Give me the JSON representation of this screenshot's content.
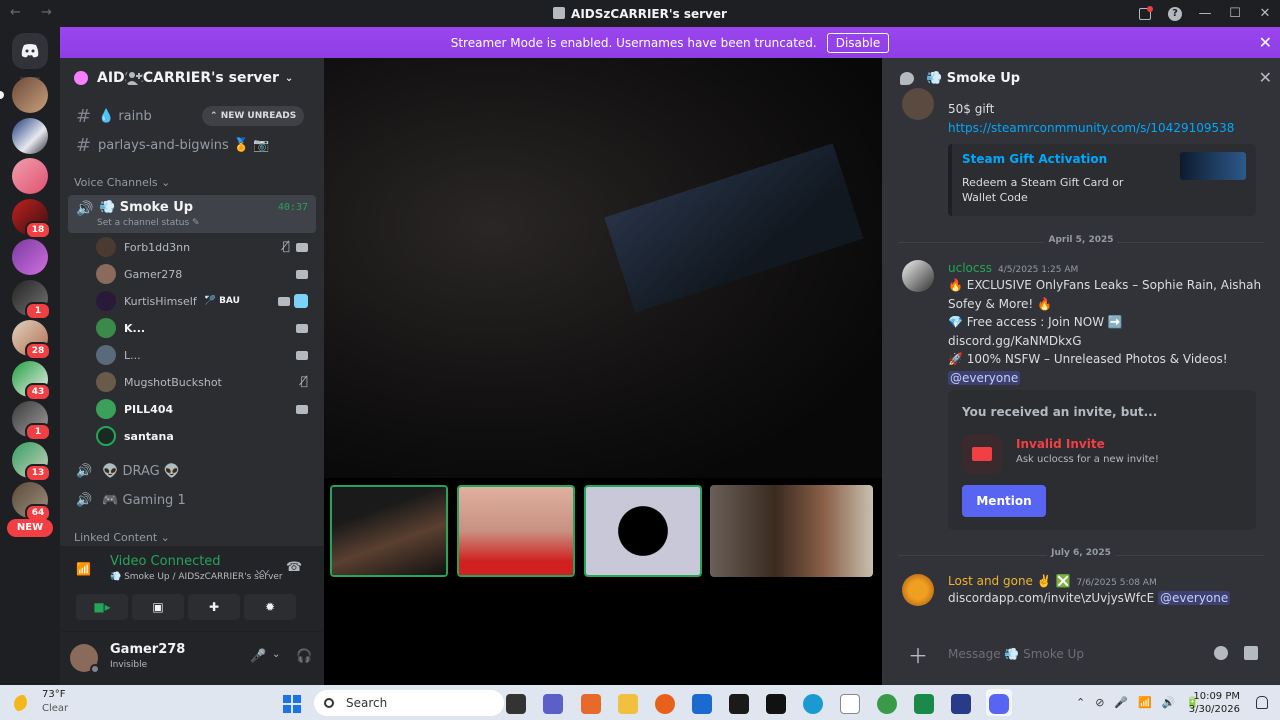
{
  "window": {
    "title": "AIDSzCARRIER's server",
    "nav_arrows": "← →"
  },
  "banner": {
    "text": "Streamer Mode is enabled. Usernames have been truncated.",
    "disable_label": "Disable"
  },
  "rail": {
    "new_label": "NEW",
    "servers": [
      {
        "badge": ""
      },
      {
        "badge": ""
      },
      {
        "badge": ""
      },
      {
        "badge": "18"
      },
      {
        "badge": ""
      },
      {
        "badge": "1"
      },
      {
        "badge": "28"
      },
      {
        "badge": "43"
      },
      {
        "badge": "1"
      },
      {
        "badge": "13"
      },
      {
        "badge": "64"
      }
    ]
  },
  "sidebar": {
    "server_name": "AIDSzCARRIER's server",
    "new_unreads": "NEW UNREADS",
    "channels": [
      {
        "name": "💧 rainb"
      },
      {
        "name": "parlays-and-bigwins 🏅 📷"
      }
    ],
    "voice_category": "Voice Channels",
    "active_voice": {
      "name": "💨 Smoke Up",
      "status": "Set a channel status",
      "timer": "40:37"
    },
    "members": [
      {
        "name": "Forb1dd3nn",
        "tag": ""
      },
      {
        "name": "Gamer278",
        "tag": ""
      },
      {
        "name": "KurtisHimself",
        "tag": "🏸 BAU"
      },
      {
        "name": "K...",
        "tag": ""
      },
      {
        "name": "L...",
        "tag": ""
      },
      {
        "name": "MugshotBuckshot",
        "tag": ""
      },
      {
        "name": "PILL404",
        "tag": ""
      },
      {
        "name": "santana",
        "tag": ""
      }
    ],
    "other_voice": [
      {
        "name": "👽 DRAG 👽"
      },
      {
        "name": "🎮 Gaming 1"
      }
    ],
    "linked_category": "Linked Content"
  },
  "voice_panel": {
    "label": "Video Connected",
    "sub": "💨 Smoke Up / AIDSzCARRIER's server"
  },
  "user_panel": {
    "name": "Gamer278",
    "status": "Invisible"
  },
  "chat": {
    "header": "💨 Smoke Up",
    "msg1": {
      "text": "50$ gift",
      "link": "https://steamrconmmunity.com/s/10429109538",
      "embed_title": "Steam Gift Activation",
      "embed_desc": "Redeem a Steam Gift Card or Wallet Code"
    },
    "date1": "April 5, 2025",
    "msg2": {
      "author": "uclocss",
      "time": "4/5/2025 1:25 AM",
      "line1": "🔥 EXCLUSIVE OnlyFans Leaks – Sophie Rain, Aishah",
      "line2": "Sofey & More! 🔥",
      "line3": "💎 Free access : Join NOW ➡️",
      "line4": "discord.gg/KaNMDkxG",
      "line5": "🚀 100% NSFW – Unreleased Photos & Videos!",
      "mention": "@everyone",
      "invite_header": "You received an invite, but...",
      "invite_title": "Invalid Invite",
      "invite_sub": "Ask uclocss for a new invite!",
      "invite_button": "Mention"
    },
    "date2": "July 6, 2025",
    "msg3": {
      "author": "Lost and gone ✌️ ❎",
      "time": "7/6/2025 5:08 AM",
      "text": "discordapp.com/invite\\zUvjysWfcE",
      "mention": "@everyone"
    },
    "composer_placeholder": "Message 💨 Smoke Up"
  },
  "taskbar": {
    "temp": "73°F",
    "condition": "Clear",
    "search": "Search",
    "time": "10:09 PM",
    "date": "3/30/2026"
  },
  "colors": {
    "banner": "#9b45ee",
    "accent": "#5865f2",
    "green": "#23a55a",
    "red": "#f23f43"
  }
}
